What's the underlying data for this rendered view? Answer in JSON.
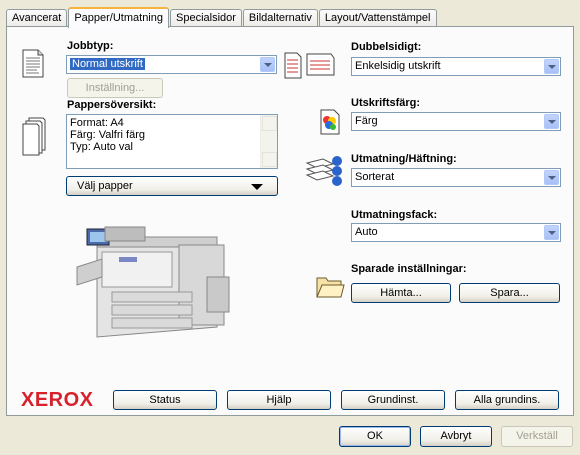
{
  "tabs": [
    {
      "label": "Avancerat",
      "active": false
    },
    {
      "label": "Papper/Utmatning",
      "active": true
    },
    {
      "label": "Specialsidor",
      "active": false
    },
    {
      "label": "Bildalternativ",
      "active": false
    },
    {
      "label": "Layout/Vattenstämpel",
      "active": false
    }
  ],
  "jobtype": {
    "label": "Jobbtyp:",
    "value": "Normal utskrift",
    "settings_button": "Inställning..."
  },
  "paper_summary": {
    "label": "Pappersöversikt:",
    "lines": [
      "Format: A4",
      "Färg: Valfri färg",
      "Typ: Auto val"
    ],
    "select_button": "Välj papper"
  },
  "duplex": {
    "label": "Dubbelsidigt:",
    "value": "Enkelsidig utskrift"
  },
  "print_color": {
    "label": "Utskriftsfärg:",
    "value": "Färg"
  },
  "output_finishing": {
    "label": "Utmatning/Häftning:",
    "value": "Sorterat"
  },
  "output_tray": {
    "label": "Utmatningsfack:",
    "value": "Auto"
  },
  "saved_settings": {
    "label": "Sparade inställningar:",
    "load_button": "Hämta...",
    "save_button": "Spara..."
  },
  "brand": {
    "logo_text": "XEROX",
    "color": "#d7212c"
  },
  "footer_buttons": {
    "status": "Status",
    "help": "Hjälp",
    "defaults": "Grundinst.",
    "all_defaults": "Alla grundins."
  },
  "dialog_buttons": {
    "ok": "OK",
    "cancel": "Avbryt",
    "apply": "Verkställ"
  },
  "icons": [
    "document-icon",
    "paper-stack-icon",
    "duplex-icon",
    "color-icon",
    "collate-icon",
    "folder-icon",
    "printer-image"
  ],
  "colors": {
    "accent": "#316ac5",
    "tab_highlight": "#f7b33b",
    "background": "#ece9d8"
  }
}
